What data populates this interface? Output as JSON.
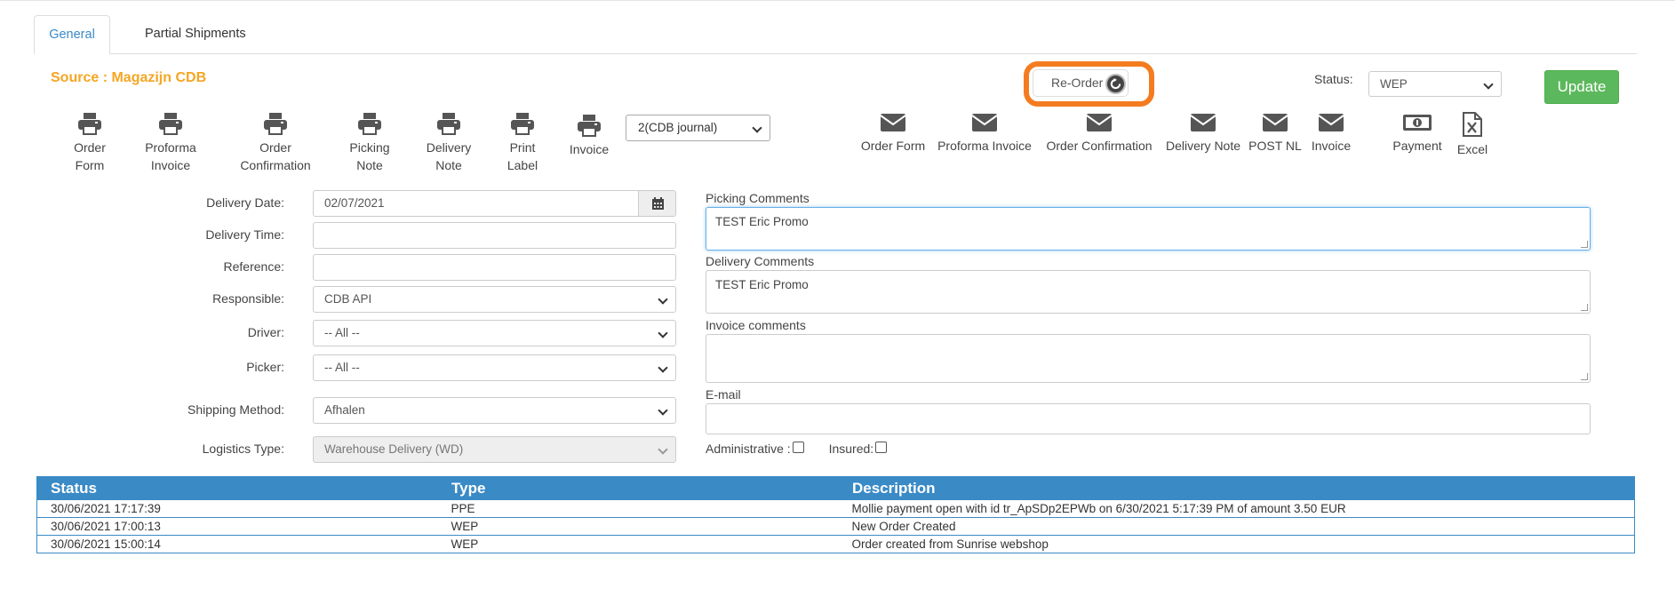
{
  "tabs": [
    {
      "label": "General",
      "active": true
    },
    {
      "label": "Partial Shipments",
      "active": false
    }
  ],
  "source_label": "Source : Magazijn CDB",
  "reorder": {
    "label": "Re-Order",
    "highlight_color": "#f47c20"
  },
  "status": {
    "label": "Status:",
    "value": "WEP"
  },
  "update_label": "Update",
  "print_tools": [
    {
      "line1": "Order",
      "line2": "Form",
      "icon": "printer-icon"
    },
    {
      "line1": "Proforma",
      "line2": "Invoice",
      "icon": "printer-icon"
    },
    {
      "line1": "Order",
      "line2": "Confirmation",
      "icon": "printer-icon"
    },
    {
      "line1": "Picking",
      "line2": "Note",
      "icon": "printer-icon"
    },
    {
      "line1": "Delivery",
      "line2": "Note",
      "icon": "printer-icon"
    },
    {
      "line1": "Print",
      "line2": "Label",
      "icon": "printer-icon"
    },
    {
      "line1": "Invoice",
      "line2": "",
      "icon": "printer-icon"
    }
  ],
  "journal_select": "2(CDB journal)",
  "mail_tools": [
    {
      "label": "Order Form",
      "icon": "envelope-icon"
    },
    {
      "label": "Proforma Invoice",
      "icon": "envelope-icon"
    },
    {
      "label": "Order Confirmation",
      "icon": "envelope-icon"
    },
    {
      "label": "Delivery Note",
      "icon": "envelope-icon"
    },
    {
      "label": "POST NL",
      "icon": "envelope-icon"
    },
    {
      "label": "Invoice",
      "icon": "envelope-icon"
    }
  ],
  "payment_label": "Payment",
  "excel_label": "Excel",
  "form": {
    "delivery_date": {
      "label": "Delivery Date:",
      "value": "02/07/2021"
    },
    "delivery_time": {
      "label": "Delivery Time:",
      "value": ""
    },
    "reference": {
      "label": "Reference:",
      "value": ""
    },
    "responsible": {
      "label": "Responsible:",
      "value": "CDB API"
    },
    "driver": {
      "label": "Driver:",
      "value": "-- All --"
    },
    "picker": {
      "label": "Picker:",
      "value": "-- All --"
    },
    "shipping_method": {
      "label": "Shipping Method:",
      "value": "Afhalen"
    },
    "logistics_type": {
      "label": "Logistics Type:",
      "value": "Warehouse Delivery (WD)"
    }
  },
  "comments": {
    "picking": {
      "label": "Picking Comments",
      "value": "TEST Eric Promo"
    },
    "delivery": {
      "label": "Delivery Comments",
      "value": "TEST Eric Promo"
    },
    "invoice": {
      "label": "Invoice comments",
      "value": ""
    },
    "email": {
      "label": "E-mail",
      "value": ""
    }
  },
  "checks": {
    "administrative": "Administrative :",
    "insured": "Insured:"
  },
  "log": {
    "headers": [
      "Status",
      "Type",
      "Description"
    ],
    "rows": [
      [
        "30/06/2021 17:17:39",
        "PPE",
        "Mollie payment open with id tr_ApSDp2EPWb on 6/30/2021 5:17:39 PM of amount 3.50 EUR"
      ],
      [
        "30/06/2021 17:00:13",
        "WEP",
        "New Order Created"
      ],
      [
        "30/06/2021 15:00:14",
        "WEP",
        "Order created from Sunrise webshop"
      ]
    ]
  }
}
